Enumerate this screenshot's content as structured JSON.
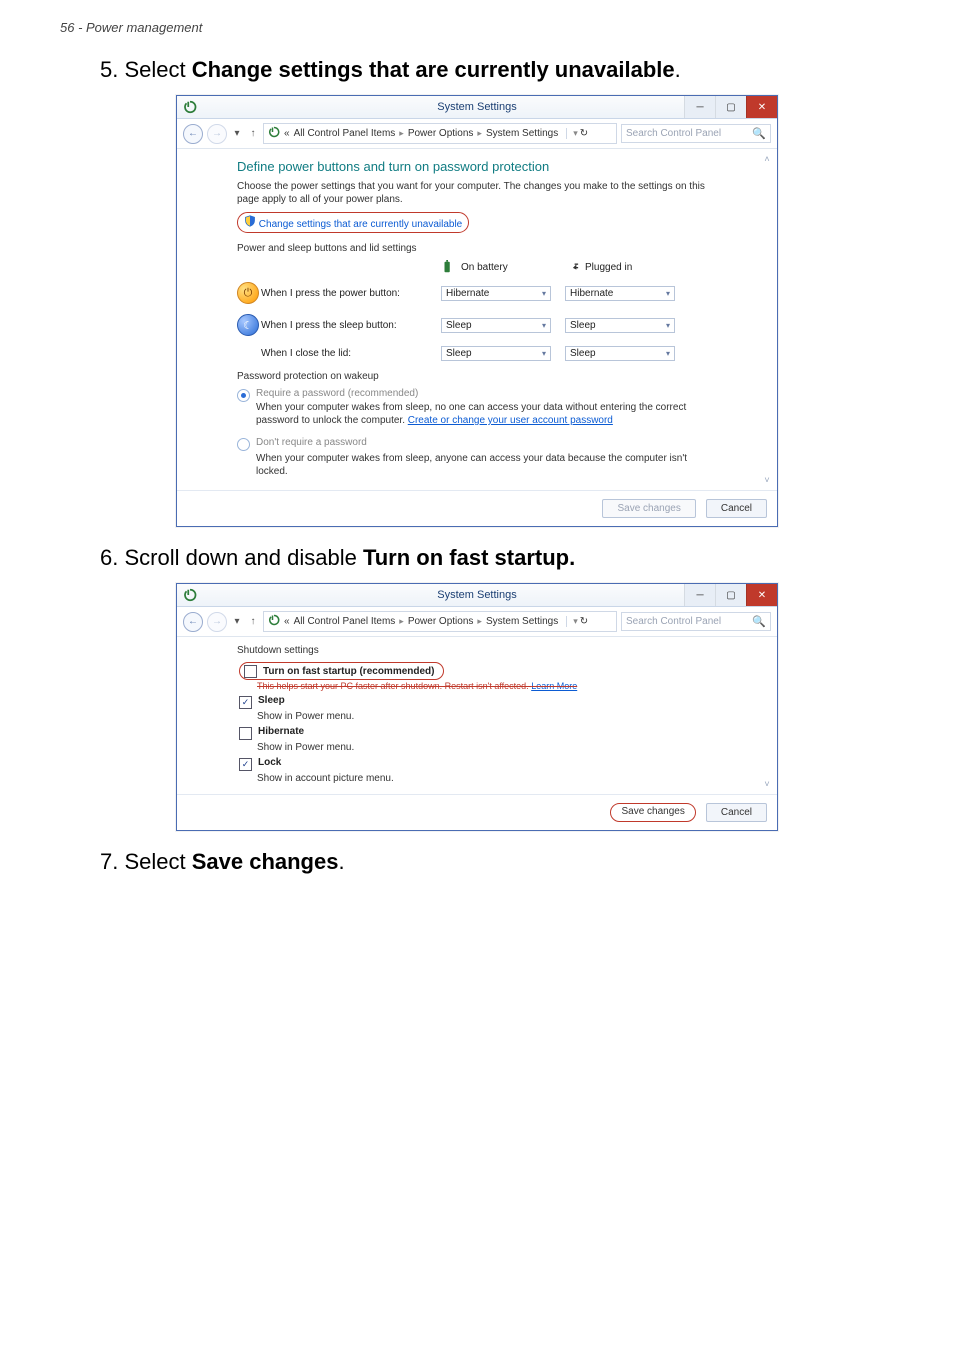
{
  "page_header": "56 - Power management",
  "steps": {
    "s5_prefix": "5. Select ",
    "s5_bold": "Change settings that are currently unavailable",
    "s5_suffix": ".",
    "s6_prefix": "6. Scroll down and disable ",
    "s6_bold": "Turn on fast startup.",
    "s7_prefix": "7. Select ",
    "s7_bold": "Save changes",
    "s7_suffix": "."
  },
  "win1": {
    "title": "System Settings",
    "breadcrumb": {
      "prefix": "«",
      "items": [
        "All Control Panel Items",
        "Power Options",
        "System Settings"
      ]
    },
    "search_placeholder": "Search Control Panel",
    "heading": "Define power buttons and turn on password protection",
    "intro": "Choose the power settings that you want for your computer. The changes you make to the settings on this page apply to all of your power plans.",
    "change_link": "Change settings that are currently unavailable",
    "section1": "Power and sleep buttons and lid settings",
    "col_battery": "On battery",
    "col_plugged": "Plugged in",
    "rows": [
      {
        "label": "When I press the power button:",
        "battery": "Hibernate",
        "plugged": "Hibernate"
      },
      {
        "label": "When I press the sleep button:",
        "battery": "Sleep",
        "plugged": "Sleep"
      },
      {
        "label": "When I close the lid:",
        "battery": "Sleep",
        "plugged": "Sleep"
      }
    ],
    "section2": "Password protection on wakeup",
    "radio1_label": "Require a password (recommended)",
    "radio1_text_a": "When your computer wakes from sleep, no one can access your data without entering the correct password to unlock the computer. ",
    "radio1_link": "Create or change your user account password",
    "radio2_label": "Don't require a password",
    "radio2_text": "When your computer wakes from sleep, anyone can access your data because the computer isn't locked.",
    "save": "Save changes",
    "cancel": "Cancel"
  },
  "win2": {
    "title": "System Settings",
    "breadcrumb": {
      "prefix": "«",
      "items": [
        "All Control Panel Items",
        "Power Options",
        "System Settings"
      ]
    },
    "search_placeholder": "Search Control Panel",
    "section": "Shutdown settings",
    "turn_on_label": "Turn on fast startup (recommended)",
    "turn_on_sub_a": "This helps start your PC faster after shutdown. Restart isn't affected. ",
    "turn_on_sub_link": "Learn More",
    "sleep_label": "Sleep",
    "sleep_sub": "Show in Power menu.",
    "hibernate_label": "Hibernate",
    "hibernate_sub": "Show in Power menu.",
    "lock_label": "Lock",
    "lock_sub": "Show in account picture menu.",
    "save": "Save changes",
    "cancel": "Cancel"
  }
}
